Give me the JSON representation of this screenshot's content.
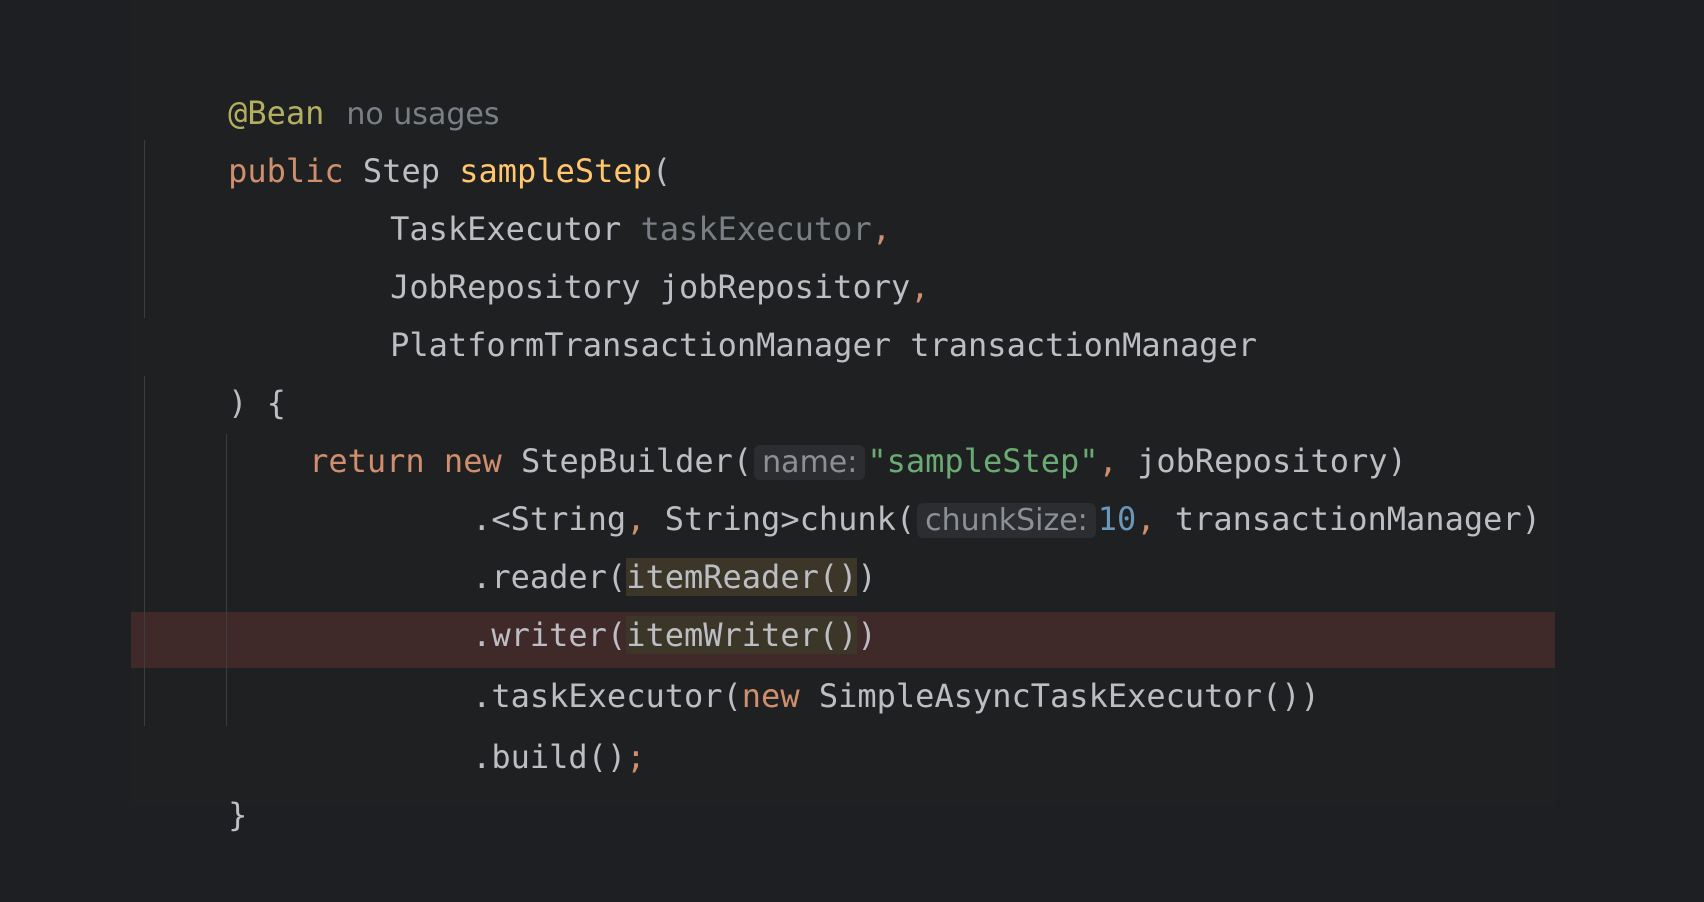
{
  "code": {
    "annotation": "@Bean",
    "usages_hint": "no usages",
    "line_signature": {
      "kw_public": "public",
      "type_step": "Step",
      "method_name": "sampleStep",
      "open_paren": "("
    },
    "params": [
      {
        "type": "TaskExecutor",
        "name": "taskExecutor",
        "suffix": ","
      },
      {
        "type": "JobRepository",
        "name": "jobRepository",
        "suffix": ","
      },
      {
        "type": "PlatformTransactionManager",
        "name": "transactionManager",
        "suffix": ""
      }
    ],
    "close_sig": ") {",
    "return_line": {
      "kw_return": "return",
      "kw_new": "new",
      "ctor": "StepBuilder(",
      "hint_name": "name:",
      "string_value": "\"sampleStep\"",
      "comma": ",",
      "arg_tail": " jobRepository)"
    },
    "chunk_line": {
      "prefix": ".<String",
      "comma1": ",",
      "mid": " String>chunk(",
      "hint_chunk": "chunkSize:",
      "number": "10",
      "comma2": ",",
      "tail": " transactionManager)"
    },
    "reader_line": {
      "prefix": ".reader(",
      "ident": "itemReader()",
      "suffix": ")"
    },
    "writer_line": {
      "prefix": ".writer(",
      "ident": "itemWriter()",
      "suffix": ")"
    },
    "executor_line": {
      "prefix": ".taskExecutor(",
      "kw_new": "new",
      "tail": " SimpleAsyncTaskExecutor())"
    },
    "build_line": {
      "prefix": ".build()",
      "semicolon": ";"
    },
    "close_brace": "}"
  },
  "colors": {
    "background": "#1f2022",
    "keyword": "#cf8e6d",
    "annotation": "#b3ae60",
    "method": "#ffc66d",
    "string": "#6aab73",
    "number": "#6897bb",
    "error_highlight": "#402929"
  }
}
